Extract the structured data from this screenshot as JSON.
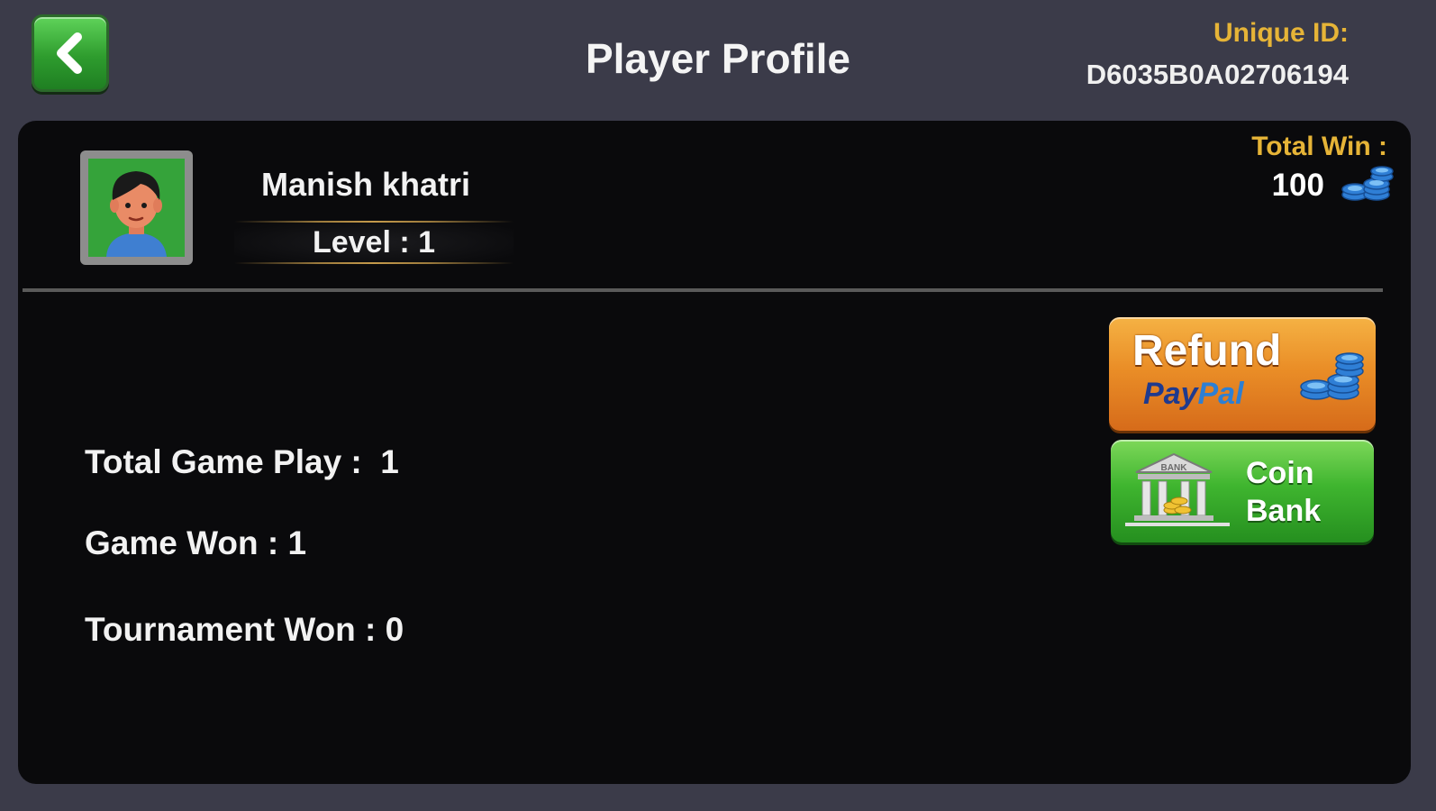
{
  "header": {
    "title": "Player Profile",
    "unique_id_label": "Unique ID:",
    "unique_id_value": "D6035B0A02706194"
  },
  "profile": {
    "name": "Manish khatri",
    "level_text": "Level :  1",
    "total_win_label": "Total Win :",
    "total_win_value": "100"
  },
  "stats": {
    "total_game_play": "Total Game Play :  1",
    "game_won": "Game Won : 1",
    "tournament_won": "Tournament Won : 0"
  },
  "buttons": {
    "refund_label": "Refund",
    "refund_paypal_a": "Pay",
    "refund_paypal_b": "Pal",
    "coin_bank_line1": "Coin",
    "coin_bank_line2": "Bank",
    "bank_sign": "BANK"
  },
  "icons": {
    "back": "chevron-left-icon",
    "coins": "coin-stack-icon",
    "bank": "bank-icon",
    "avatar": "avatar"
  },
  "colors": {
    "background": "#3b3b49",
    "panel": "#0a0a0c",
    "gold_label": "#e6b437",
    "back_green": "#2e9c2e",
    "refund_orange": "#ea8e27",
    "coinbank_green": "#3fb52f"
  }
}
